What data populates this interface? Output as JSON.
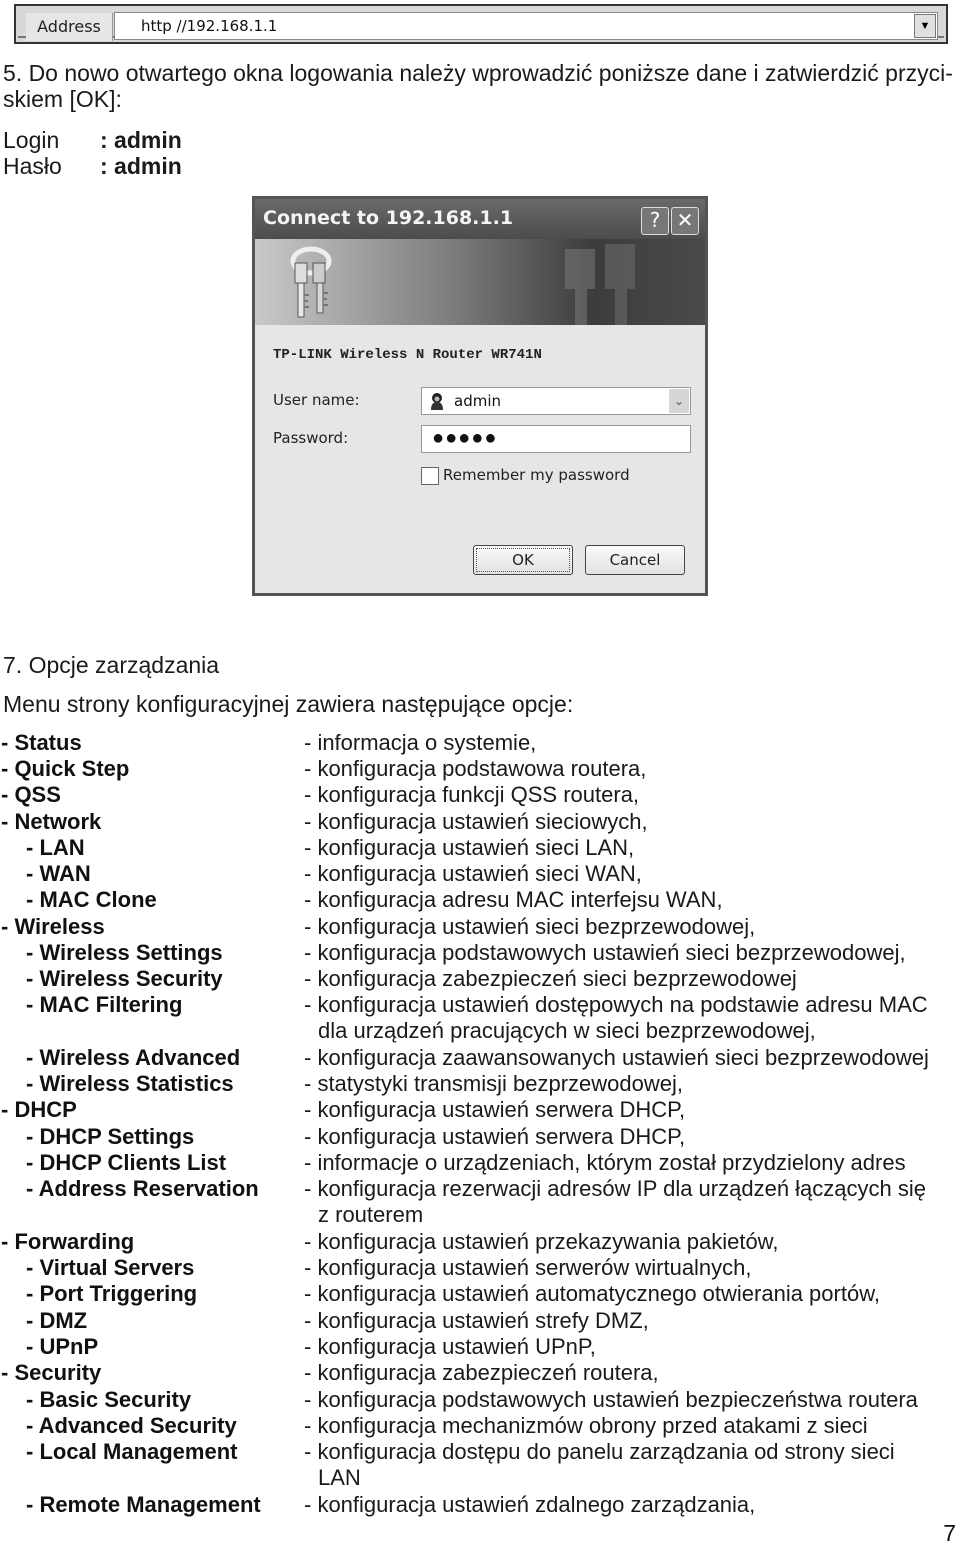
{
  "address_bar": {
    "label": "Address",
    "url": "http //192.168.1.1",
    "dropdown_icon": "triangle-down-icon"
  },
  "step5": {
    "instruction_line1": "5. Do nowo otwartego okna logowania należy wprowadzić poniższe dane i zatwierdzić przyci-",
    "instruction_line2": "skiem [OK]:",
    "login_label": "Login",
    "login_value": ": admin",
    "password_label": "Hasło",
    "password_value": ": admin"
  },
  "dialog": {
    "title": "Connect to 192.168.1.1",
    "help_button": "?",
    "close_button": "✕",
    "heading": "TP-LINK Wireless N Router WR741N",
    "username_label": "User name:",
    "username_value": "admin",
    "password_label": "Password:",
    "password_value": "●●●●●",
    "remember_label": "Remember my password",
    "remember_checked": false,
    "ok_label": "OK",
    "cancel_label": "Cancel"
  },
  "step7": {
    "heading": "7. Opcje zarządzania",
    "intro": "Menu strony konfiguracyjnej zawiera następujące opcje:",
    "menu": [
      {
        "name": "- Status",
        "level": 0,
        "desc": "- informacja o systemie,"
      },
      {
        "name": "- Quick Step",
        "level": 0,
        "desc": "- konfiguracja podstawowa routera,"
      },
      {
        "name": "- QSS",
        "level": 0,
        "desc": "- konfiguracja funkcji QSS routera,"
      },
      {
        "name": "- Network",
        "level": 0,
        "desc": "- konfiguracja ustawień sieciowych,"
      },
      {
        "name": "- LAN",
        "level": 1,
        "desc": "- konfiguracja ustawień sieci LAN,"
      },
      {
        "name": "- WAN",
        "level": 1,
        "desc": "- konfiguracja ustawień sieci WAN,"
      },
      {
        "name": "- MAC Clone",
        "level": 1,
        "desc": "- konfiguracja adresu MAC interfejsu WAN,"
      },
      {
        "name": "- Wireless",
        "level": 0,
        "desc": "- konfiguracja ustawień sieci bezprzewodowej,"
      },
      {
        "name": "- Wireless Settings",
        "level": 1,
        "desc": "- konfiguracja podstawowych ustawień sieci bezprzewodowej,"
      },
      {
        "name": "- Wireless Security",
        "level": 1,
        "desc": "- konfiguracja zabezpieczeń sieci bezprzewodowej"
      },
      {
        "name": "- MAC Filtering",
        "level": 1,
        "desc": "- konfiguracja ustawień dostępowych na podstawie adresu MAC",
        "desc_cont": "dla urządzeń pracujących w sieci bezprzewodowej,"
      },
      {
        "name": "- Wireless Advanced",
        "level": 1,
        "desc": "- konfiguracja zaawansowanych ustawień sieci bezprzewodowej"
      },
      {
        "name": "- Wireless Statistics",
        "level": 1,
        "desc": "- statystyki transmisji bezprzewodowej,"
      },
      {
        "name": "- DHCP",
        "level": 0,
        "desc": "- konfiguracja ustawień serwera DHCP,"
      },
      {
        "name": "- DHCP Settings",
        "level": 1,
        "desc": "- konfiguracja ustawień serwera DHCP,"
      },
      {
        "name": "- DHCP Clients List",
        "level": 1,
        "desc": "- informacje o urządzeniach, którym został przydzielony adres"
      },
      {
        "name": "- Address Reservation",
        "level": 1,
        "desc": "- konfiguracja rezerwacji adresów IP dla urządzeń łączących się",
        "desc_cont": "z routerem"
      },
      {
        "name": "- Forwarding",
        "level": 0,
        "desc": "- konfiguracja ustawień przekazywania pakietów,"
      },
      {
        "name": "- Virtual Servers",
        "level": 1,
        "desc": "- konfiguracja ustawień serwerów wirtualnych,"
      },
      {
        "name": "- Port Triggering",
        "level": 1,
        "desc": "- konfiguracja ustawień automatycznego otwierania portów,"
      },
      {
        "name": "- DMZ",
        "level": 1,
        "desc": "- konfiguracja ustawień strefy DMZ,"
      },
      {
        "name": "- UPnP",
        "level": 1,
        "desc": "- konfiguracja ustawień UPnP,"
      },
      {
        "name": "- Security",
        "level": 0,
        "desc": "- konfiguracja zabezpieczeń routera,"
      },
      {
        "name": "- Basic Security",
        "level": 1,
        "desc": "- konfiguracja podstawowych ustawień bezpieczeństwa routera"
      },
      {
        "name": "- Advanced Security",
        "level": 1,
        "desc": "- konfiguracja mechanizmów obrony przed atakami z sieci"
      },
      {
        "name": "- Local Management",
        "level": 1,
        "desc": "- konfiguracja dostępu do panelu zarządzania od strony sieci",
        "desc_cont": "LAN"
      },
      {
        "name": "- Remote Management",
        "level": 1,
        "desc": "- konfiguracja ustawień zdalnego zarządzania,"
      }
    ]
  },
  "page_number": "7"
}
